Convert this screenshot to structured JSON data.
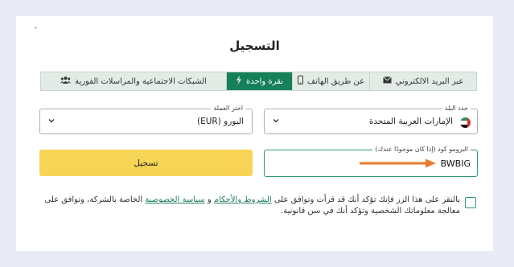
{
  "form": {
    "title": "التسجيل",
    "close_glyph": "ˇ"
  },
  "tabs": [
    {
      "label": "عبر البريد الالكتروني",
      "icon": "envelope-icon",
      "active": false
    },
    {
      "label": "عن طريق الهاتف",
      "icon": "phone-icon",
      "active": false
    },
    {
      "label": "نقرة واحدة",
      "icon": "lightning-icon",
      "active": true
    },
    {
      "label": "الشبكات الاجتماعية والمراسلات الفورية",
      "icon": "users-icon",
      "active": false
    }
  ],
  "country": {
    "label": "حدد البلد",
    "value": "الإمارات العربية المتحدة",
    "flag": "uae-flag-icon"
  },
  "currency": {
    "label": "اختر العملة",
    "value": "اليورو (EUR)"
  },
  "promo": {
    "label": "البرومو كود (إذا كان موجودًا عندك)",
    "value": "BWBIG"
  },
  "register_button": {
    "label": "تسجيل"
  },
  "terms": {
    "text_start": "بالنقر على هذا الزر فإنك تؤكد أنك قد قرأت وتوافق على ",
    "link_terms": "الشروط والأحكام",
    "text_and": " و ",
    "link_privacy": "سياسة الخصوصية",
    "text_end": " الخاصة بالشركة، وتوافق على معالجة معلوماتك الشخصية وتؤكد أنك في سن قانونية."
  },
  "colors": {
    "accent_green": "#15805a",
    "button_yellow": "#f6d455",
    "arrow_orange": "#ee7a2e",
    "background": "#e8ebf5"
  }
}
